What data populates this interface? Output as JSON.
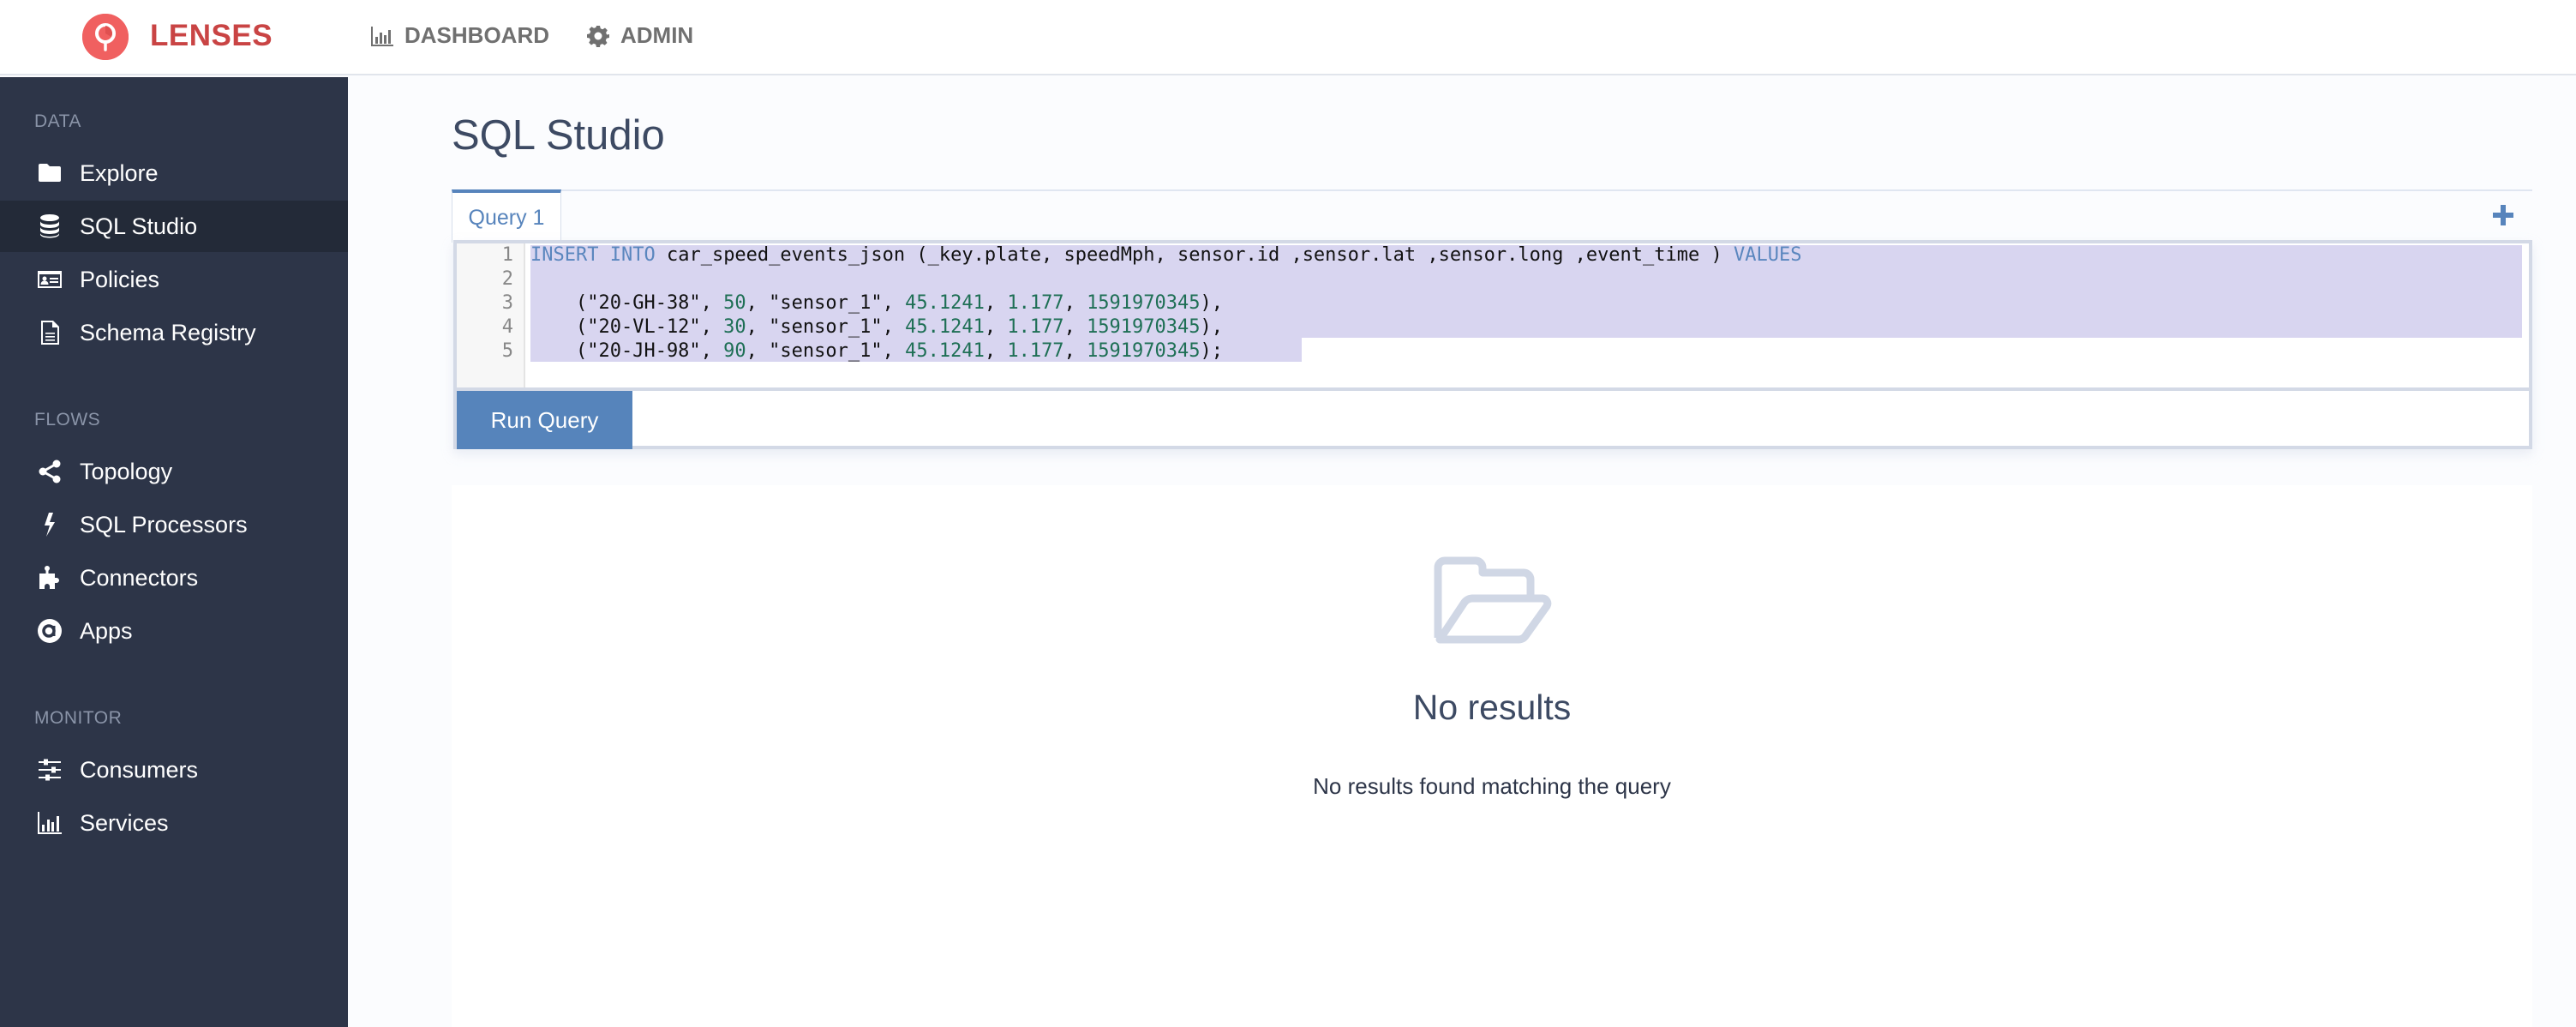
{
  "header": {
    "brand": "LENSES",
    "nav": [
      {
        "label": "DASHBOARD",
        "icon": "bar-chart-icon"
      },
      {
        "label": "ADMIN",
        "icon": "gear-icon"
      }
    ]
  },
  "sidebar": {
    "sections": [
      {
        "label": "DATA",
        "items": [
          {
            "label": "Explore",
            "icon": "folder-icon"
          },
          {
            "label": "SQL Studio",
            "icon": "database-icon",
            "active": true
          },
          {
            "label": "Policies",
            "icon": "id-card-icon"
          },
          {
            "label": "Schema Registry",
            "icon": "document-icon"
          }
        ]
      },
      {
        "label": "FLOWS",
        "items": [
          {
            "label": "Topology",
            "icon": "share-icon"
          },
          {
            "label": "SQL Processors",
            "icon": "bolt-icon"
          },
          {
            "label": "Connectors",
            "icon": "puzzle-icon"
          },
          {
            "label": "Apps",
            "icon": "at-icon"
          }
        ]
      },
      {
        "label": "MONITOR",
        "items": [
          {
            "label": "Consumers",
            "icon": "sliders-icon"
          },
          {
            "label": "Services",
            "icon": "bar-chart-icon"
          }
        ]
      }
    ]
  },
  "main": {
    "title": "SQL Studio",
    "tabs": [
      {
        "label": "Query 1",
        "active": true
      }
    ],
    "add_tab_icon": "plus-icon",
    "editor": {
      "line_numbers": [
        "1",
        "2",
        "3",
        "4",
        "5"
      ],
      "lines": [
        "INSERT INTO car_speed_events_json (_key.plate, speedMph, sensor.id ,sensor.lat ,sensor.long ,event_time ) VALUES",
        "",
        "    (\"20-GH-38\", 50, \"sensor_1\", 45.1241, 1.177, 1591970345),",
        "    (\"20-VL-12\", 30, \"sensor_1\", 45.1241, 1.177, 1591970345),",
        "    (\"20-JH-98\", 90, \"sensor_1\", 45.1241, 1.177, 1591970345);"
      ]
    },
    "run_button": "Run Query",
    "results": {
      "icon": "open-folder-icon",
      "title": "No results",
      "message": "No results found matching the query"
    }
  },
  "colors": {
    "brand": "#c94444",
    "logo": "#f06060",
    "accent": "#5684bb",
    "sidebar_bg": "#2d3548",
    "sidebar_active": "#232a38",
    "selection": "#d8d5f0",
    "keyword": "#5a86be",
    "number": "#1e6f55"
  }
}
